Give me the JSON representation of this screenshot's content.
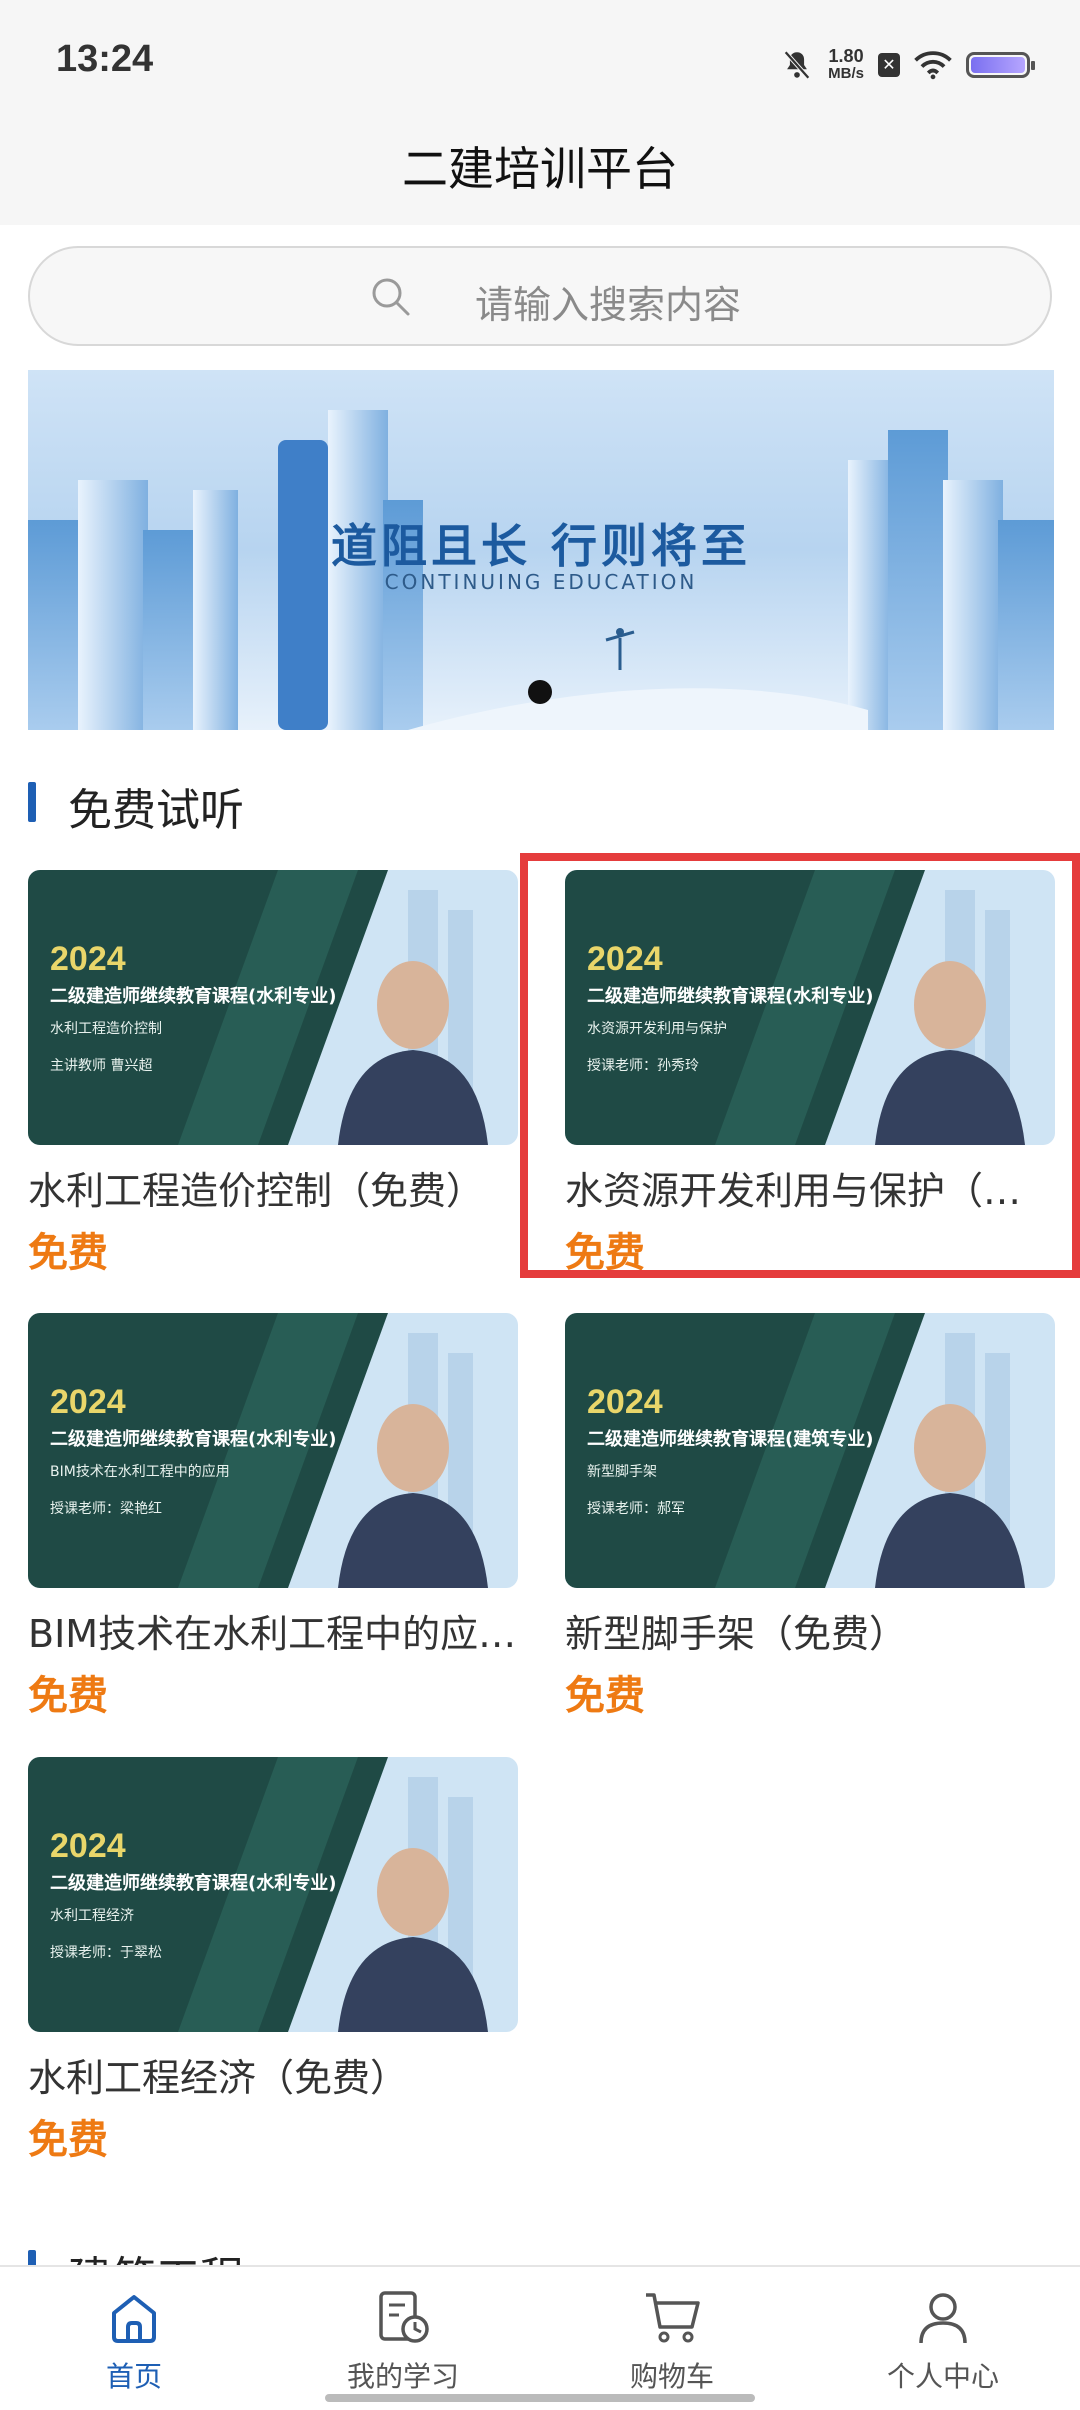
{
  "status_bar": {
    "time": "13:24",
    "net_speed": "1.80",
    "net_unit": "MB/s",
    "sim": "✕"
  },
  "header": {
    "title": "二建培训平台"
  },
  "search": {
    "placeholder": "请输入搜索内容"
  },
  "banner": {
    "title": "道阻且长 行则将至",
    "subtitle": "CONTINUING EDUCATION"
  },
  "sections": [
    {
      "title": "免费试听"
    },
    {
      "title": "建筑工程"
    }
  ],
  "courses": [
    {
      "title": "水利工程造价控制（免费）",
      "price": "免费",
      "thumb_year": "2024",
      "thumb_program": "二级建造师继续教育课程(水利专业)",
      "thumb_course": "水利工程造价控制",
      "thumb_teacher": "主讲教师  曹兴超"
    },
    {
      "title": "水资源开发利用与保护（免费）",
      "price": "免费",
      "thumb_year": "2024",
      "thumb_program": "二级建造师继续教育课程(水利专业)",
      "thumb_course": "水资源开发利用与保护",
      "thumb_teacher": "授课老师：孙秀玲"
    },
    {
      "title": "BIM技术在水利工程中的应用（免费）",
      "price": "免费",
      "thumb_year": "2024",
      "thumb_program": "二级建造师继续教育课程(水利专业)",
      "thumb_course": "BIM技术在水利工程中的应用",
      "thumb_teacher": "授课老师：梁艳红"
    },
    {
      "title": "新型脚手架（免费）",
      "price": "免费",
      "thumb_year": "2024",
      "thumb_program": "二级建造师继续教育课程(建筑专业)",
      "thumb_course": "新型脚手架",
      "thumb_teacher": "授课老师：郝军"
    },
    {
      "title": "水利工程经济（免费）",
      "price": "免费",
      "thumb_year": "2024",
      "thumb_program": "二级建造师继续教育课程(水利专业)",
      "thumb_course": "水利工程经济",
      "thumb_teacher": "授课老师：于翠松"
    }
  ],
  "tabs": [
    {
      "label": "首页",
      "icon": "home-icon",
      "active": true
    },
    {
      "label": "我的学习",
      "icon": "study-clock-icon",
      "active": false
    },
    {
      "label": "购物车",
      "icon": "cart-icon",
      "active": false
    },
    {
      "label": "个人中心",
      "icon": "person-icon",
      "active": false
    }
  ],
  "colors": {
    "accent": "#1e5fb4",
    "price": "#ee7a13",
    "highlight": "#e53c3c"
  }
}
